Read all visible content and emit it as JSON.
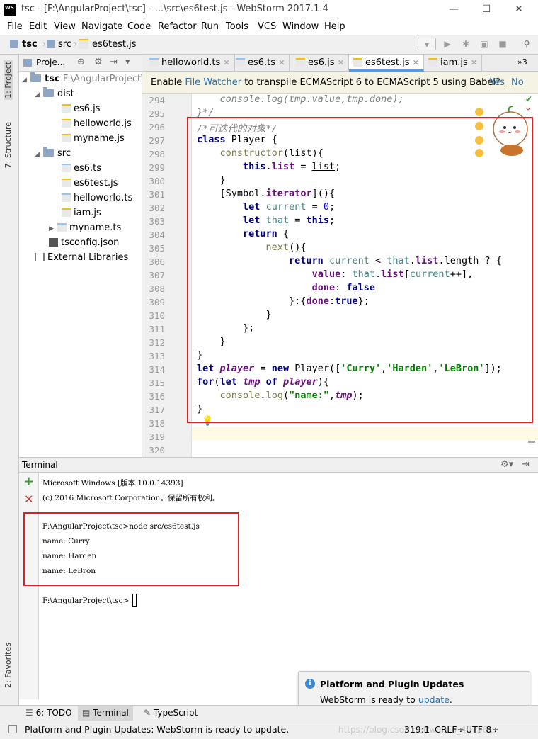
{
  "titlebar": {
    "title": "tsc - [F:\\AngularProject\\tsc] - ...\\src\\es6test.js - WebStorm 2017.1.4",
    "logo": "WS",
    "minimize": "—",
    "maximize": "☐",
    "close": "✕"
  },
  "menu": [
    "File",
    "Edit",
    "View",
    "Navigate",
    "Code",
    "Refactor",
    "Run",
    "Tools",
    "VCS",
    "Window",
    "Help"
  ],
  "nav": {
    "crumbs": [
      "tsc",
      "src",
      "es6test.js"
    ]
  },
  "left_strip": {
    "project_tab": "1: Project",
    "structure_tab": "7: Structure",
    "favorites_tab": "2: Favorites"
  },
  "project_panel": {
    "header": "Proje...",
    "root": "tsc",
    "root_path": "F:\\AngularProject\\t",
    "items": [
      {
        "label": "dist",
        "type": "folder"
      },
      {
        "label": "es6.js",
        "type": "js"
      },
      {
        "label": "helloworld.js",
        "type": "js"
      },
      {
        "label": "myname.js",
        "type": "js"
      },
      {
        "label": "src",
        "type": "folder"
      },
      {
        "label": "es6.ts",
        "type": "ts"
      },
      {
        "label": "es6test.js",
        "type": "js"
      },
      {
        "label": "helloworld.ts",
        "type": "ts"
      },
      {
        "label": "iam.js",
        "type": "js"
      },
      {
        "label": "myname.ts",
        "type": "ts"
      },
      {
        "label": "tsconfig.json",
        "type": "json"
      },
      {
        "label": "External Libraries",
        "type": "lib"
      }
    ]
  },
  "tabs": [
    "helloworld.ts",
    "es6.ts",
    "es6.js",
    "es6test.js",
    "iam.js"
  ],
  "tabs_overflow": "»3",
  "banner": {
    "text_a": "Enable ",
    "link": "File Watcher",
    "text_b": " to transpile ECMAScript 6 to ECMAScript 5 using Babel?",
    "yes": "Yes",
    "no": "No"
  },
  "line_numbers": [
    "294",
    "295",
    "296",
    "297",
    "298",
    "299",
    "300",
    "301",
    "302",
    "303",
    "304",
    "305",
    "306",
    "307",
    "308",
    "309",
    "310",
    "311",
    "312",
    "313",
    "314",
    "315",
    "316",
    "317",
    "318",
    "319",
    "320"
  ],
  "terminal": {
    "title": "Terminal",
    "lines": [
      "Microsoft Windows [版本 10.0.14393]",
      "(c) 2016 Microsoft Corporation。保留所有权利。",
      "",
      "F:\\AngularProject\\tsc>node src/es6test.js",
      "name: Curry",
      "name: Harden",
      "name: LeBron",
      "",
      "F:\\AngularProject\\tsc>"
    ]
  },
  "notification": {
    "title": "Platform and Plugin Updates",
    "text": "WebStorm is ready to ",
    "link": "update",
    "end": "."
  },
  "bottom_tabs": [
    "6: TODO",
    "Terminal",
    "TypeScript"
  ],
  "status": {
    "message": "Platform and Plugin Updates: WebStorm is ready to update.",
    "position": "319:1",
    "line_sep": "CRLF÷",
    "encoding": "UTF-8÷",
    "watermark": "https://blog.csdn.net/weixin_41756..."
  },
  "colors": {
    "highlight_red": "#e02020",
    "accent": "#5b9bd5",
    "link": "#2470b3"
  }
}
